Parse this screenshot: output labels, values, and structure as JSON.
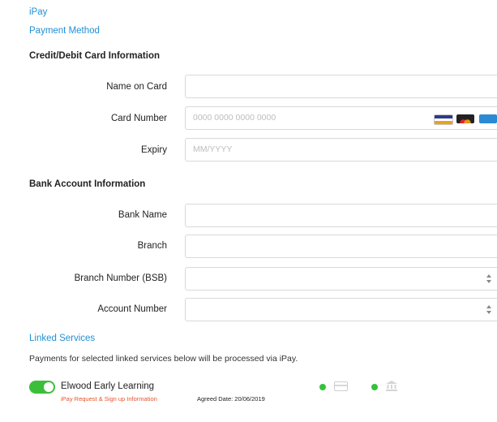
{
  "breadcrumb": {
    "ipay": "iPay",
    "payment_method": "Payment Method"
  },
  "card_section": {
    "title": "Credit/Debit Card Information",
    "name_label": "Name on Card",
    "name_value": "",
    "number_label": "Card Number",
    "number_placeholder": "0000 0000 0000 0000",
    "expiry_label": "Expiry",
    "expiry_placeholder": "MM/YYYY",
    "card_logos": [
      "visa-icon",
      "mastercard-icon",
      "amex-icon"
    ]
  },
  "bank_section": {
    "title": "Bank Account Information",
    "bank_name_label": "Bank Name",
    "branch_label": "Branch",
    "bsb_label": "Branch Number (BSB)",
    "account_label": "Account Number"
  },
  "linked": {
    "title": "Linked Services",
    "description": "Payments for selected linked services below will be processed via iPay.",
    "service_name": "Elwood Early Learning",
    "service_sub": "iPay Request & Sign up Information",
    "agreed": "Agreed Date: 20/06/2019",
    "status_icons": [
      "card-icon",
      "bank-icon"
    ]
  },
  "colors": {
    "accent": "#1f8fd6",
    "toggle": "#3bbf3b",
    "status": "#35c23a",
    "sub_link": "#e8532a"
  }
}
